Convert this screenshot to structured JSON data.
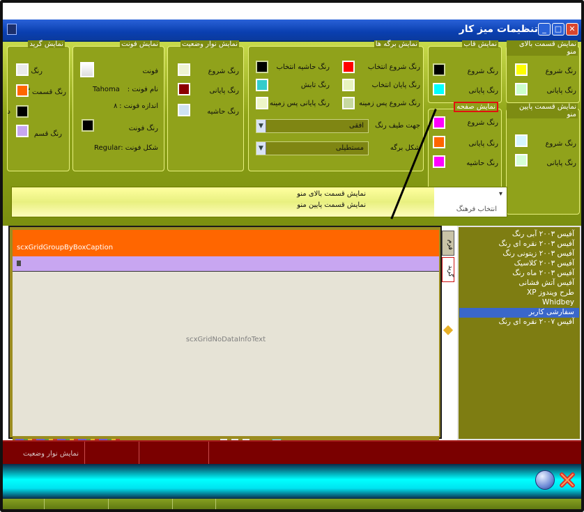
{
  "window": {
    "title": "تنظیمات میز کار"
  },
  "groups": {
    "top_menu": {
      "title": "نمایش قسمت بالای منو",
      "start_label": "رنگ شروع",
      "end_label": "رنگ پایانی",
      "start_color": "#ffff00",
      "end_color": "#ccffcc"
    },
    "bottom_menu": {
      "title": "نمایش قسمت پایین منو",
      "start_label": "رنگ شروع",
      "end_label": "رنگ پایانی",
      "start_color": "#d6f6ff",
      "end_color": "#d6ffd6"
    },
    "frame": {
      "title": "نمایش قاب",
      "start_label": "رنگ شروع",
      "end_label": "رنگ پایانی",
      "start_color": "#000000",
      "end_color": "#00ffff"
    },
    "page": {
      "title": "نمایش صفحه",
      "start_label": "رنگ شروع",
      "end_label": "رنگ پایانی",
      "border_label": "رنگ حاشیه",
      "start_color": "#ff00ff",
      "end_color": "#ff6600",
      "border_color": "#ff00ff"
    },
    "sheets": {
      "title": "نمایش برگه ها",
      "select_start": "رنگ شروع انتخاب",
      "select_end": "رنگ پایان انتخاب",
      "bg_start": "رنگ شروع پس زمینه",
      "select_border": "رنگ حاشیه انتخاب",
      "shine": "رنگ تابش",
      "bg_end": "رنگ پایانی پس زمینه",
      "gradient_dir_label": "جهت طیف رنگ",
      "gradient_dir_value": "افقی",
      "sheet_shape_label": "شکل برگه",
      "sheet_shape_value": "مستطیلی",
      "select_start_color": "#ff0000",
      "select_end_color": "#e8f3c0",
      "bg_start_color": "#c7d9a0",
      "select_border_color": "#000000",
      "shine_color": "#33cccc",
      "bg_end_color": "#eef6c8"
    },
    "statusbar": {
      "title": "نمایش نوار وضعیت",
      "start_label": "رنگ شروع",
      "end_label": "رنگ پایانی",
      "border_label": "رنگ حاشیه",
      "start_color": "#eef3d2",
      "end_color": "#8b0000",
      "border_color": "#cfe2f3"
    },
    "font": {
      "title": "نمایش فونت",
      "font_label": "فونت",
      "name_label": "نام فونت :",
      "name_value": "Tahoma",
      "size_label": "اندازه فونت :",
      "size_value": "۸",
      "color_label": "رنگ فونت",
      "style_label": "شکل فونت :",
      "style_value": "Regular"
    },
    "grid": {
      "title": "نمایش گرید",
      "color_label": "رنگ",
      "section_color_label": "رنگ قسمت گ",
      "section_label2": "د",
      "color_label2": "رنگ قسم",
      "c1": "#eaeaea",
      "c2": "#ff6600",
      "c3": "#000000",
      "c4": "#c7a6f1"
    }
  },
  "culture": {
    "label": "انتخاب فرهنگ",
    "line1": "نمایش قسمت بالای منو",
    "line2": "نمایش قسمت پایین منو"
  },
  "grid_preview": {
    "group_caption": "scxGridGroupByBoxCaption",
    "no_data": "scxGridNoDataInfoText"
  },
  "side_tabs": {
    "tab1": "فرم",
    "tab2": "گرید"
  },
  "themes": [
    "آفیس ۲۰۰۳ آبی رنگ",
    "آفیس ۲۰۰۳ نقره ای رنگ",
    "آفیس ۲۰۰۳ زیتونی رنگ",
    "آفیس ۲۰۰۳ کلاسیک",
    "آفیس ۲۰۰۳ ماه رنگ",
    "آفیس آتش فشانی",
    "طرح ویندوز XP",
    "Whidbey",
    "سفارشی کاربر",
    "آفیس ۲۰۰۷ نقره ای رنگ"
  ],
  "selected_theme_index": 8,
  "statusbar_preview": {
    "label": "نمایش نوار وضعیت"
  }
}
